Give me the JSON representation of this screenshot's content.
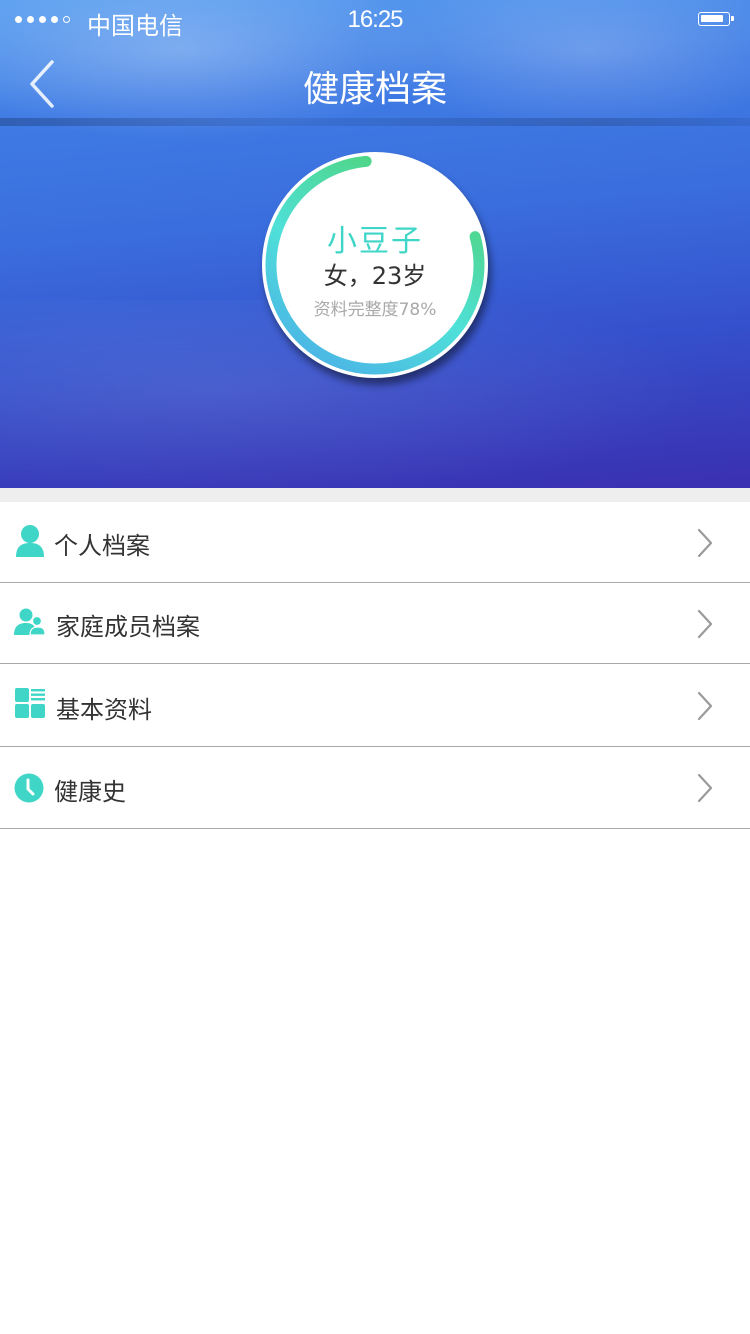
{
  "status_bar": {
    "carrier": "中国电信",
    "time": "16:25"
  },
  "nav": {
    "title": "健康档案",
    "back_icon": "chevron-left-icon"
  },
  "profile": {
    "name": "小豆子",
    "gender_age": "女，23岁",
    "completeness_text": "资料完整度78%",
    "completeness": 0.78
  },
  "menu": {
    "items": [
      {
        "label": "个人档案",
        "icon": "person-icon"
      },
      {
        "label": "家庭成员档案",
        "icon": "family-icon"
      },
      {
        "label": "基本资料",
        "icon": "grid-list-icon"
      },
      {
        "label": "健康史",
        "icon": "clock-icon"
      }
    ],
    "chevron_icon": "chevron-right-icon"
  },
  "colors": {
    "accent": "#3fd6c8",
    "hero_top": "#5a9ff0",
    "hero_bottom": "#3a2fb0",
    "divider": "#a9a9a9"
  }
}
